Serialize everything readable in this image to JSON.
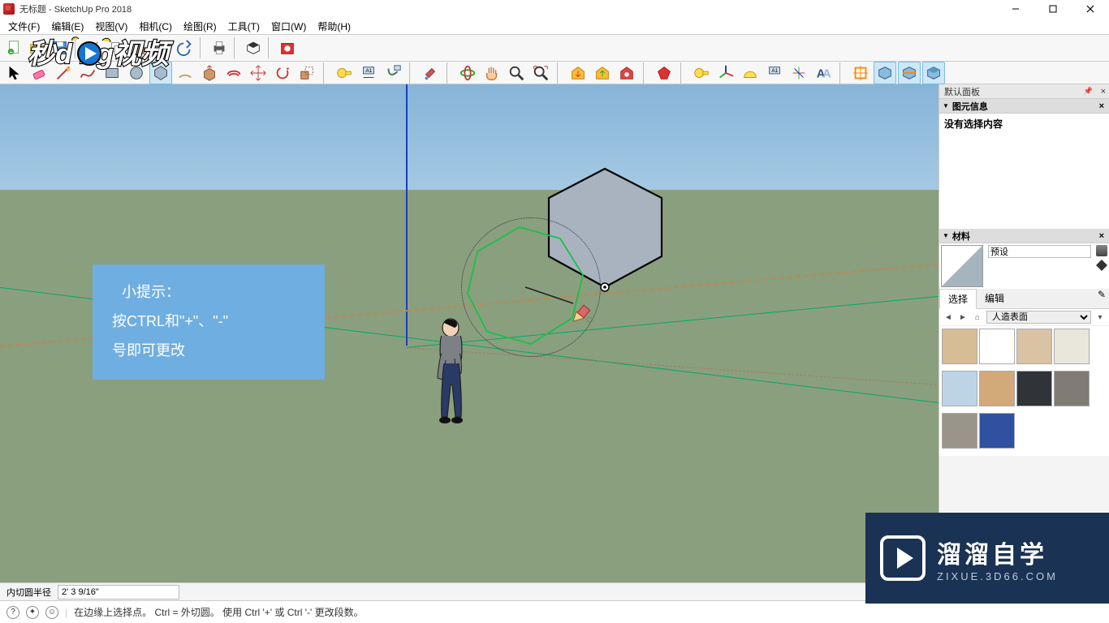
{
  "window": {
    "title": "无标题 - SketchUp Pro 2018"
  },
  "menu": {
    "file": "文件(F)",
    "edit": "编辑(E)",
    "view": "视图(V)",
    "camera": "相机(C)",
    "draw": "绘图(R)",
    "tools": "工具(T)",
    "window": "窗口(W)",
    "help": "帮助(H)"
  },
  "toolbar1": {
    "items": [
      "new",
      "open",
      "save",
      "cut",
      "copy",
      "paste",
      "undo",
      "redo",
      "print",
      "model-info",
      "preferences"
    ]
  },
  "toolbar2": {
    "items": [
      "select",
      "eraser",
      "line",
      "rectangle",
      "circle",
      "polygon",
      "arc",
      "pushpull",
      "move",
      "rotate",
      "scale",
      "offset",
      "tape",
      "protractor",
      "text",
      "axes",
      "dimension",
      "paint",
      "orbit",
      "pan",
      "zoom",
      "zoom-extents",
      "prev",
      "next",
      "iso",
      "top",
      "front",
      "right",
      "walk",
      "lookaround",
      "section",
      "outliner",
      "layers",
      "shadows",
      "fog",
      "ext1",
      "ext2",
      "ext3",
      "ext4",
      "ext5",
      "ext6",
      "ext7",
      "ext8",
      "ext9",
      "ext10",
      "ext11",
      "ext12",
      "ext13",
      "sandbox1",
      "sandbox2",
      "solid1",
      "solid2"
    ]
  },
  "tip": {
    "title": "小提示：",
    "line1": "按CTRL和\"+\"、\"-\"",
    "line2": "号即可更改"
  },
  "panels": {
    "tray_title": "默认面板",
    "entity": {
      "title": "图元信息",
      "body": "没有选择内容"
    },
    "materials": {
      "title": "材料",
      "current_name": "预设",
      "tab_select": "选择",
      "tab_edit": "编辑",
      "library": "人造表面",
      "swatches": [
        "#d6bd95",
        "#ffffff",
        "#d9c3a3",
        "#e9e6dc",
        "#bcd4e6",
        "#d2a978",
        "#303338",
        "#807b75",
        "#9a958b",
        "#3050a0"
      ]
    }
  },
  "vcb": {
    "label": "内切圆半径",
    "value": "2' 3 9/16\""
  },
  "status": {
    "hint": "在边缘上选择点。 Ctrl = 外切圆。 使用 Ctrl '+' 或 Ctrl '-' 更改段数。"
  },
  "brand": {
    "line1": "溜溜自学",
    "line2": "ZIXUE.3D66.COM"
  },
  "overlay_logo": "秒dong视频"
}
